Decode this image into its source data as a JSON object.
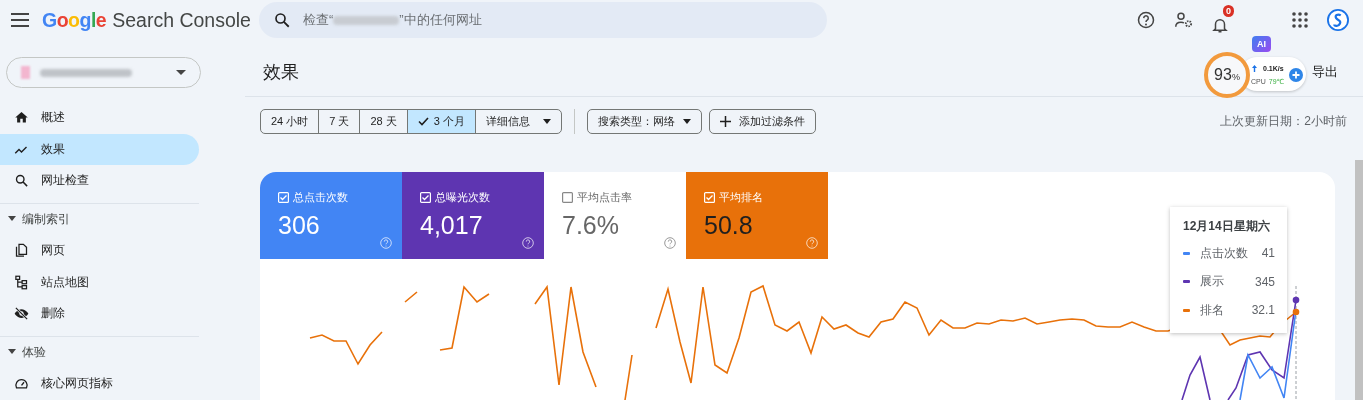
{
  "header": {
    "product": "Search Console",
    "logo": "Google",
    "search": {
      "placeholder_before": "检查“",
      "placeholder_after": "”中的任何网址"
    },
    "notification_count": "0"
  },
  "sidebar": {
    "items": [
      {
        "kind": "item",
        "label": "概述",
        "selected": false
      },
      {
        "kind": "item",
        "label": "效果",
        "selected": true
      },
      {
        "kind": "item",
        "label": "网址检查",
        "selected": false
      },
      {
        "kind": "section",
        "label": "编制索引",
        "expanded": true
      },
      {
        "kind": "item",
        "label": "网页",
        "selected": false
      },
      {
        "kind": "item",
        "label": "站点地图",
        "selected": false
      },
      {
        "kind": "item",
        "label": "删除",
        "selected": false
      },
      {
        "kind": "section",
        "label": "体验",
        "expanded": true
      },
      {
        "kind": "item",
        "label": "核心网页指标",
        "selected": false
      }
    ]
  },
  "page": {
    "title": "效果",
    "export": "导出",
    "last_updated": "上次更新日期：2小时前"
  },
  "monitor": {
    "percent": "93",
    "unit": "%",
    "speed": "0.1K/s",
    "cpu_label": "CPU",
    "cpu_temp": "79℃",
    "ai_badge": "AI"
  },
  "date_ranges": [
    {
      "kind": "range",
      "label": "24 小时",
      "selected": false
    },
    {
      "kind": "range",
      "label": "7 天",
      "selected": false
    },
    {
      "kind": "range",
      "label": "28 天",
      "selected": false
    },
    {
      "kind": "range",
      "label": "3 个月",
      "selected": true
    },
    {
      "kind": "menu",
      "label": "详细信息",
      "selected": false
    }
  ],
  "filters": [
    {
      "kind": "dropdown",
      "label": "搜索类型：网络"
    },
    {
      "kind": "add",
      "label": "添加过滤条件"
    }
  ],
  "metrics": [
    {
      "label": "总点击次数",
      "value": "306",
      "checked": true,
      "color": "#4285f4"
    },
    {
      "label": "总曝光次数",
      "value": "4,017",
      "checked": true,
      "color": "#5e35b1"
    },
    {
      "label": "平均点击率",
      "value": "7.6%",
      "checked": false
    },
    {
      "label": "平均排名",
      "value": "50.8",
      "checked": true,
      "color": "#e8710a"
    }
  ],
  "tooltip": {
    "date": "12月14日星期六",
    "rows": [
      {
        "name": "点击次数",
        "value": "41",
        "color": "#4285f4"
      },
      {
        "name": "展示",
        "value": "345",
        "color": "#5e35b1"
      },
      {
        "name": "排名",
        "value": "32.1",
        "color": "#e8710a"
      }
    ]
  }
}
